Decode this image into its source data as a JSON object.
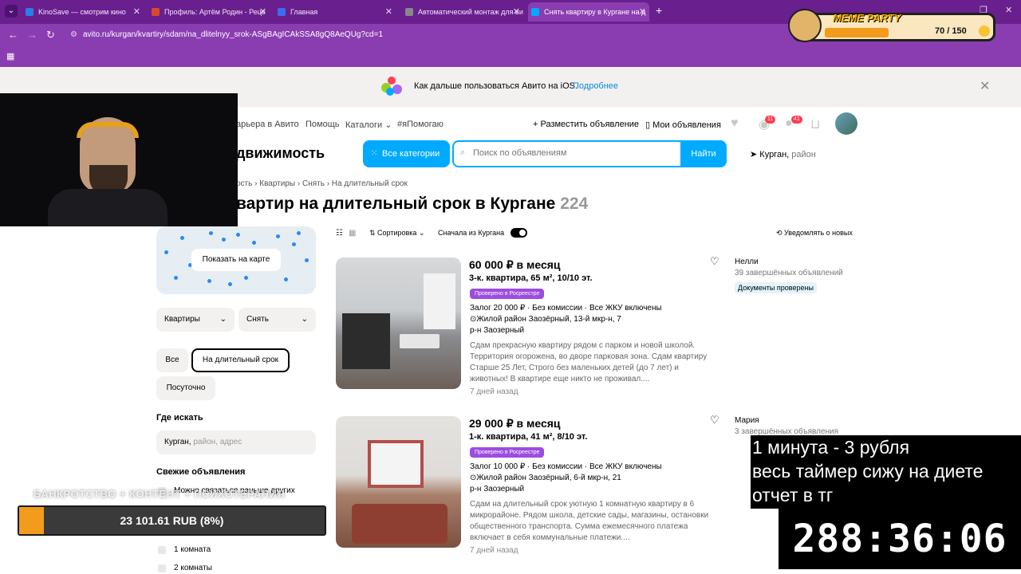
{
  "browser": {
    "tabs": [
      {
        "label": "KinoSave — смотрим кино",
        "color": "#2b7de9"
      },
      {
        "label": "Профиль: Артём Родин - Реце",
        "color": "#d64b2b"
      },
      {
        "label": "Главная",
        "color": "#3b6df0"
      },
      {
        "label": "Автоматический монтаж для ви",
        "color": "#888888"
      },
      {
        "label": "Снять квартиру в Кургане на д",
        "color": "#00aaff"
      }
    ],
    "url": "avito.ru/kurgan/kvartiry/sdam/na_dlitelnyy_srok-ASgBAgICAkSSA8gQ8AeQUg?cd=1"
  },
  "banner": {
    "text": "Как дальше пользоваться Авито на iOS.",
    "link": "Подробнее"
  },
  "header": {
    "nav": [
      "арьера в Авито",
      "Помощь",
      "Каталоги ⌄",
      "#яПомогаю"
    ],
    "post_ad": "+ Разместить объявление",
    "my_ads": "Мои объявления",
    "notif_badge": "11",
    "msg_badge": "41",
    "section": "движимость",
    "all_categories": "Все категории",
    "search_placeholder": "Поиск по объявлениям",
    "search_button": "Найти",
    "location": "Курган,",
    "location_suffix": " район"
  },
  "breadcrumb": "ость › Квартиры › Снять › На длительный срок",
  "heading": {
    "title": "вартир на длительный срок в Кургане",
    "count": "224"
  },
  "filters": {
    "map_button": "Показать на карте",
    "type": "Квартиры",
    "deal": "Снять",
    "term_all": "Все",
    "term_long": "На длительный срок",
    "term_daily": "Посуточно",
    "where_title": "Где искать",
    "where_value": "Курган,",
    "where_placeholder": " район, адрес",
    "fresh_title": "Свежие объявления",
    "fresh_option": "Можно связаться раньше других",
    "rooms": [
      "1 комната",
      "2 комнаты"
    ]
  },
  "toolbar": {
    "sort": "Сортировка ⌄",
    "near": "Сначала из Кургана",
    "notify": "Уведомлять о новых"
  },
  "listings": [
    {
      "price": "60 000 ₽ в месяц",
      "subtitle": "3-к. квартира, 65 м², 10/10 эт.",
      "verified": "Проверено в Росреестре",
      "params": "Залог 20 000 ₽ · Без комиссии · Все ЖКУ включены",
      "address": "Жилой район Заозёрный, 13-й мкр-н, 7",
      "district": "р-н Заозерный",
      "description": "Сдам прекрасную квартиру рядом с парком и новой школой. Территория огорожена, во дворе парковая зона. Сдам квартиру Старше 25 Лет, Строго без маленьких детей (до 7 лет) и животных! В квартире еще никто не проживал....",
      "age": "7 дней назад",
      "seller": "Нелли",
      "seller_sub": "39 завершённых объявлений",
      "seller_badge": "Документы проверены"
    },
    {
      "price": "29 000 ₽ в месяц",
      "subtitle": "1-к. квартира, 41 м², 8/10 эт.",
      "verified": "Проверено в Росреестре",
      "params": "Залог 10 000 ₽ · Без комиссии · Все ЖКУ включены",
      "address": "Жилой район Заозёрный, 6-й мкр-н, 21",
      "district": "р-н Заозерный",
      "description": "Сдам на длительный срок уютную 1 комнатную квартиру в 6 микрорайоне. Рядом школа, детские сады, магазины, остановки общественного транспорта. Сумма ежемесячного платежа включает в себя коммунальные платежи....",
      "age": "7 дней назад",
      "seller": "Мария",
      "seller_sub": "3 завершённых объявления",
      "seller_badge": ""
    }
  ],
  "overlay": {
    "meme_title": "MEME PARTY",
    "meme_count": "70 / 150",
    "meme_progress": 0.47,
    "donate_title": "БАНКРОТСТВО + КОНТЕНТ + ПСИХОТЕРАПИЯ",
    "donate_amount": "23 101.61 RUB (8%)",
    "donate_progress": 0.08,
    "donate_min": "0",
    "donate_max": "300 000",
    "rule_1": "1 минута - 3 рубля",
    "rule_2": "весь таймер сижу на диете",
    "rule_3": "отчет в тг",
    "timer": "288:36:06"
  }
}
